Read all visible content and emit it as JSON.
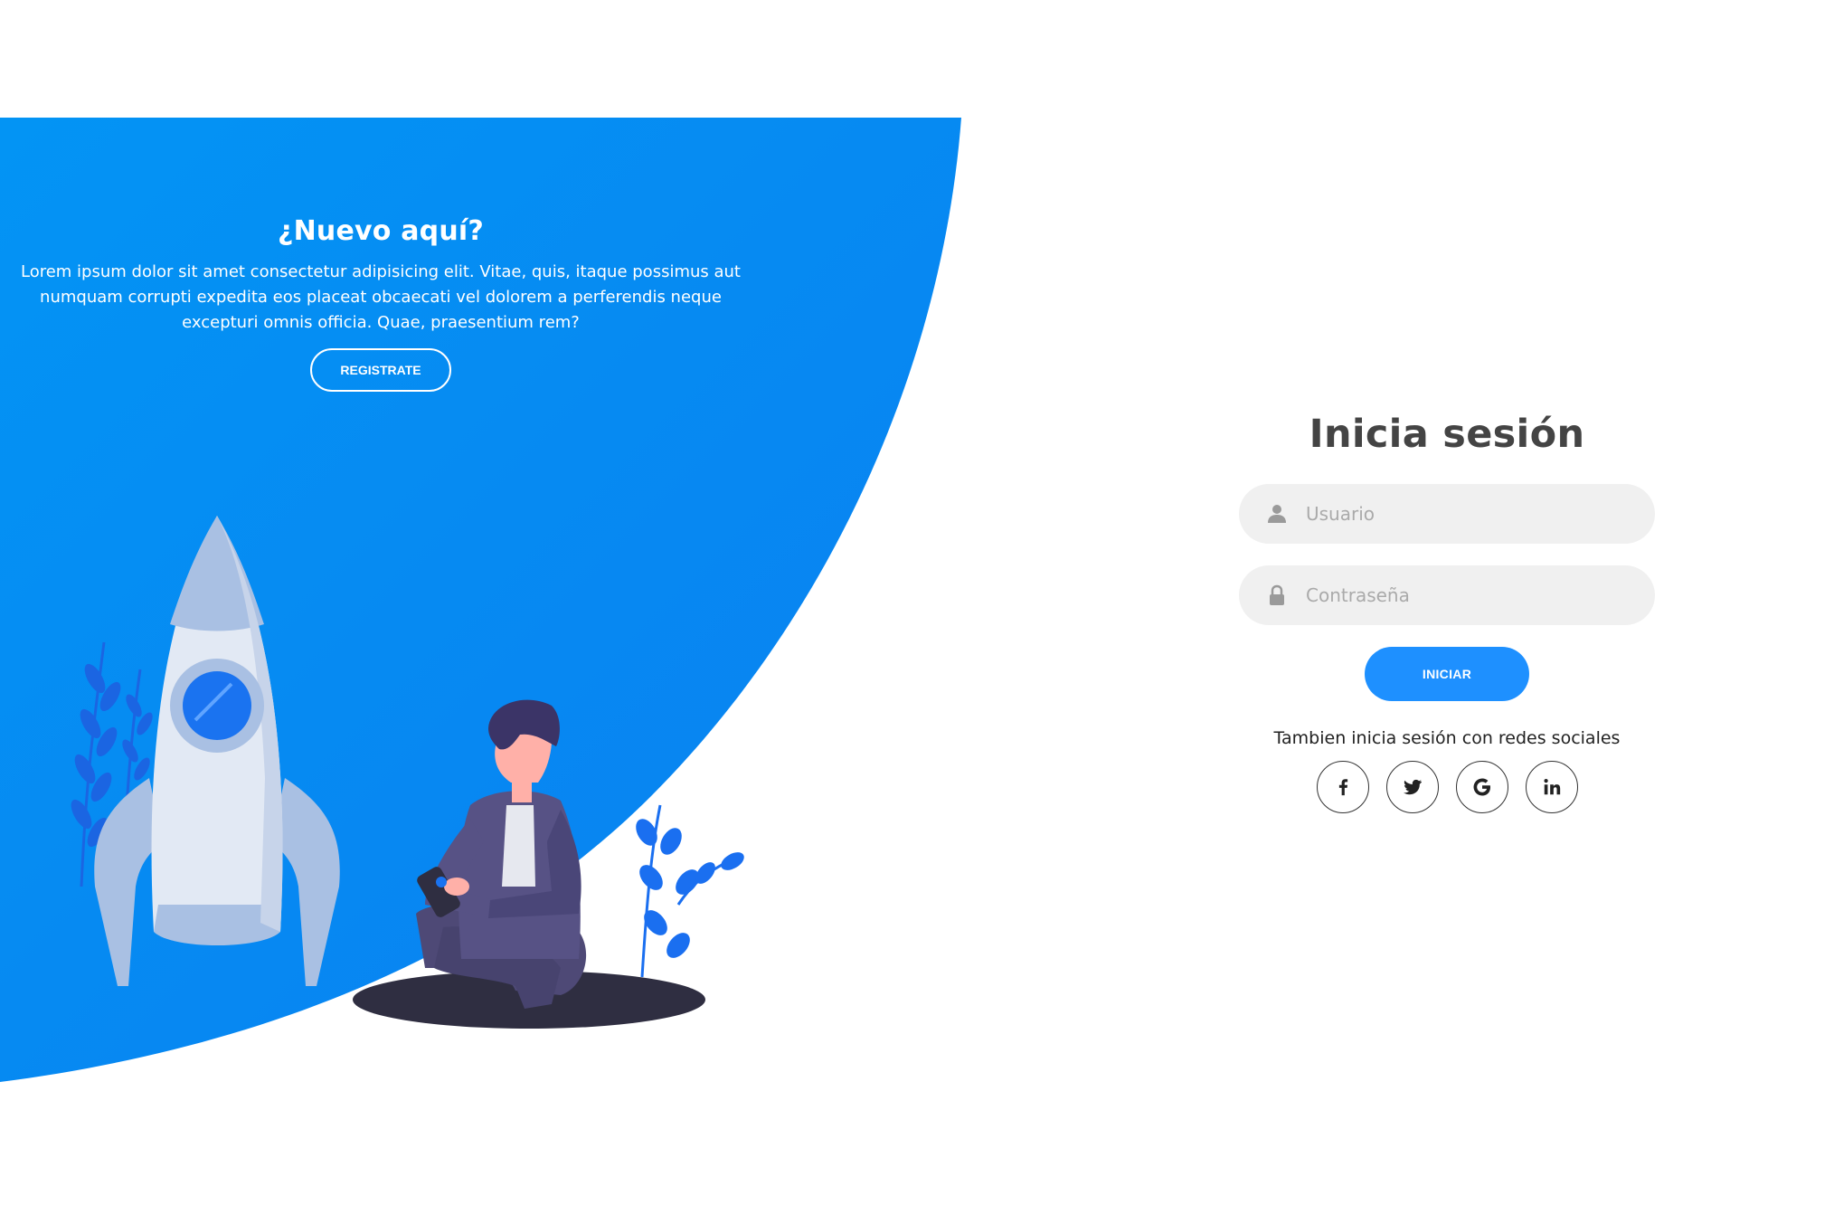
{
  "promo": {
    "title": "¿Nuevo aquí?",
    "text": "Lorem ipsum dolor sit amet consectetur adipisicing elit. Vitae, quis, itaque possimus aut numquam corrupti expedita eos placeat obcaecati vel dolorem a perferendis neque excepturi omnis officia. Quae, praesentium rem?",
    "register_label": "REGISTRATE"
  },
  "login": {
    "title": "Inicia sesión",
    "username_placeholder": "Usuario",
    "password_placeholder": "Contraseña",
    "submit_label": "INICIAR",
    "social_text": "Tambien inicia sesión con redes sociales",
    "social": [
      {
        "label": "f",
        "icon": "facebook-icon"
      },
      {
        "label": "t",
        "icon": "twitter-icon"
      },
      {
        "label": "G",
        "icon": "google-icon"
      },
      {
        "label": "in",
        "icon": "linkedin-icon"
      }
    ]
  },
  "colors": {
    "accent": "#1e90ff",
    "panel_blue": "#0a8cf5",
    "text_dark": "#444444",
    "input_bg": "#f0f0f0"
  }
}
